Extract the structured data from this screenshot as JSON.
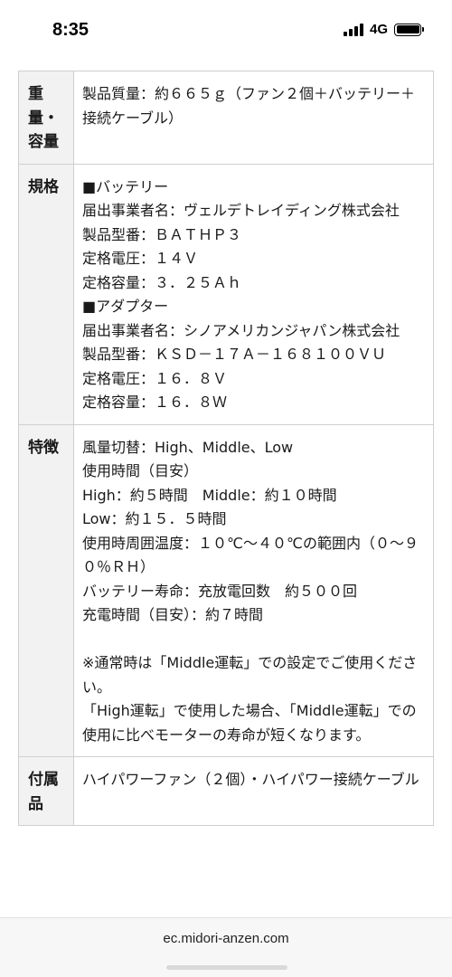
{
  "status_bar": {
    "time": "8:35",
    "network": "4G",
    "signal_bars": 4,
    "battery_level": 1.0
  },
  "specs": [
    {
      "label": "重量・容量",
      "lines": [
        "製品質量：約６６５ｇ（ファン２個＋バッテリー＋接続ケーブル）"
      ]
    },
    {
      "label": "規格",
      "lines": [
        "■バッテリー",
        "届出事業者名：ヴェルデトレイディング株式会社",
        "製品型番：ＢＡＴＨＰ３",
        "定格電圧：１４Ｖ",
        "定格容量：３．２５Ａｈ",
        "■アダプター",
        "届出事業者名：シノアメリカンジャパン株式会社",
        "製品型番：ＫＳＤ－１７Ａ－１６８１００ＶＵ",
        "定格電圧：１６．８Ｖ",
        "定格容量：１６．８Ｗ"
      ]
    },
    {
      "label": "特徴",
      "lines": [
        "風量切替：High、Middle、Low",
        "使用時間（目安）",
        "High：約５時間　Middle：約１０時間",
        "Low：約１５．５時間",
        "使用時周囲温度：１０℃～４０℃の範囲内（０～９０％ＲＨ）",
        "バッテリー寿命：充放電回数　約５００回",
        "充電時間（目安）：約７時間",
        "",
        "※通常時は「Middle運転」での設定でご使用ください。",
        "「High運転」で使用した場合、「Middle運転」での使用に比べモーターの寿命が短くなります。"
      ]
    },
    {
      "label": "付属品",
      "lines": [
        "ハイパワーファン（２個）・ハイパワー接続ケーブル"
      ]
    }
  ],
  "browser": {
    "url": "ec.midori-anzen.com"
  }
}
